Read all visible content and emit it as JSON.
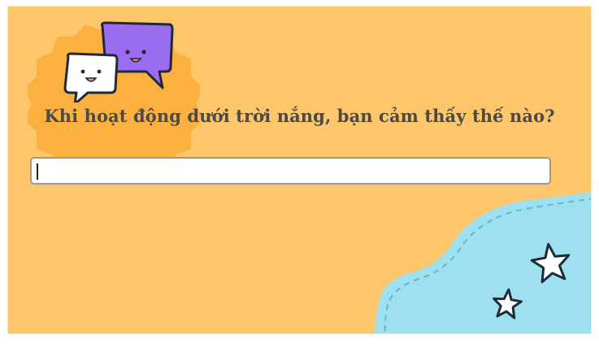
{
  "quiz": {
    "question": "Khi hoạt động dưới trời nắng, bạn cảm thấy thế nào?",
    "answer_value": "",
    "answer_placeholder": ""
  },
  "icons": {
    "decoration": "chat-bubbles-icon",
    "stars": "star-icon"
  },
  "colors": {
    "background": "#fdc66b",
    "badge": "#fbb040",
    "bubble_purple": "#9b6cf0",
    "bubble_white": "#ffffff",
    "sea": "#9fe0f0",
    "text": "#4a4a4a"
  }
}
